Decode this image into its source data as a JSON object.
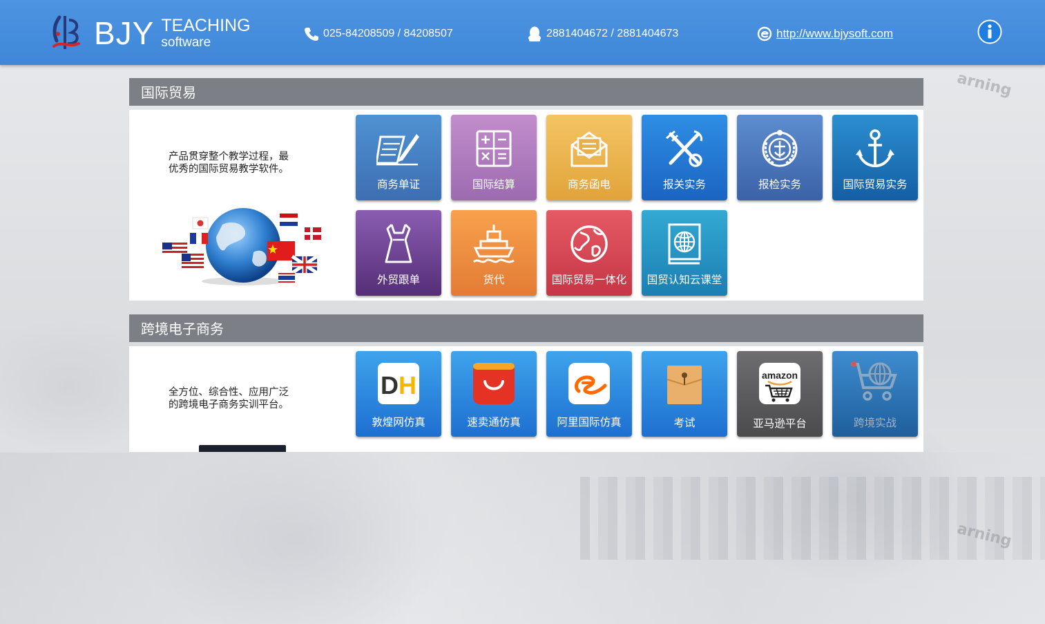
{
  "header": {
    "logo_bjy": "BJY",
    "logo_teaching": "TEACHING",
    "logo_software": "software",
    "phone": "025-84208509 / 84208507",
    "qq": "2881404672 / 2881404673",
    "website": "http://www.bjysoft.com"
  },
  "background": {
    "word_1": "arning",
    "word_2": "arning"
  },
  "sections": [
    {
      "title": "国际贸易",
      "description_line1": "产品贯穿整个教学过程，最",
      "description_line2": "优秀的国际贸易教学软件。",
      "tiles": [
        {
          "label": "商务单证",
          "icon": "document-pen-icon",
          "color": "#4f92d3"
        },
        {
          "label": "国际结算",
          "icon": "calculator-icon",
          "color": "#c28dcb"
        },
        {
          "label": "商务函电",
          "icon": "envelope-icon",
          "color": "#f4c564"
        },
        {
          "label": "报关实务",
          "icon": "customs-emblem-icon",
          "color": "#2f8ee4"
        },
        {
          "label": "报检实务",
          "icon": "inspection-emblem-icon",
          "color": "#5d8dd0"
        },
        {
          "label": "国际贸易实务",
          "icon": "anchor-icon",
          "color": "#2c8fd0"
        },
        {
          "label": "外贸跟单",
          "icon": "dress-icon",
          "color": "#8a5db1"
        },
        {
          "label": "货代",
          "icon": "ship-icon",
          "color": "#f7a14c"
        },
        {
          "label": "国际贸易一体化",
          "icon": "globe-icon",
          "color": "#e55a64"
        },
        {
          "label": "国贸认知云课堂",
          "icon": "globe-book-icon",
          "color": "#33a9d3"
        }
      ]
    },
    {
      "title": "跨境电子商务",
      "description_line1": "全方位、综合性、应用广泛",
      "description_line2": "的跨境电子商务实训平台。",
      "tiles": [
        {
          "label": "敦煌网仿真",
          "icon": "dh-logo-icon",
          "color": "#3ea3ec"
        },
        {
          "label": "速卖通仿真",
          "icon": "aliexpress-bag-icon",
          "color": "#3ea3ec"
        },
        {
          "label": "阿里国际仿真",
          "icon": "alibaba-logo-icon",
          "color": "#3ea3ec"
        },
        {
          "label": "考试",
          "icon": "envelope-folder-icon",
          "color": "#3ea3ec"
        },
        {
          "label": "亚马逊平台",
          "icon": "amazon-cart-icon",
          "color": "#6e6e70"
        },
        {
          "label": "跨境实战",
          "icon": "globe-cart-icon",
          "color": "#3e8ccf"
        }
      ]
    }
  ]
}
